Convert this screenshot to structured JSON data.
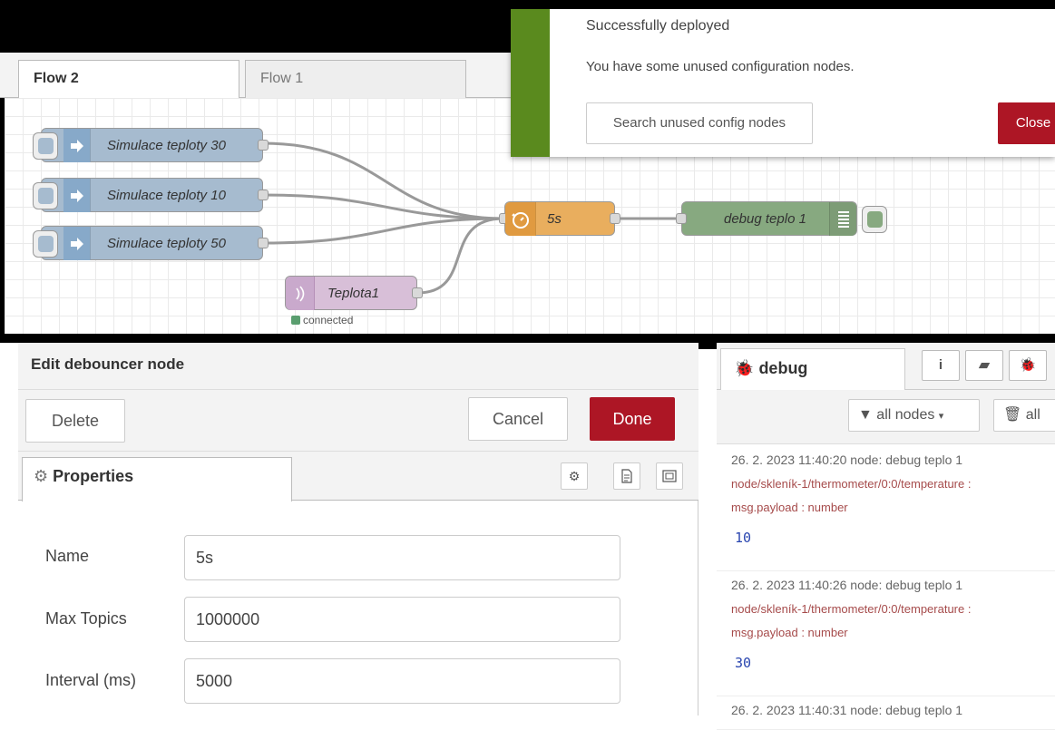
{
  "tabs": [
    {
      "label": "Flow 2",
      "active": true
    },
    {
      "label": "Flow 1",
      "active": false
    }
  ],
  "flow": {
    "inject_nodes": [
      "Simulace teploty 30",
      "Simulace teploty 10",
      "Simulace teploty 50"
    ],
    "debouncer_label": "5s",
    "debug_label": "debug teplo 1",
    "mqtt_label": "Teplota1",
    "mqtt_status": "connected"
  },
  "notification": {
    "title": "Successfully deployed",
    "message": "You have some unused configuration nodes.",
    "search_button": "Search unused config nodes",
    "close_button": "Close"
  },
  "edit": {
    "title": "Edit debouncer node",
    "delete_label": "Delete",
    "cancel_label": "Cancel",
    "done_label": "Done",
    "properties_tab": "Properties",
    "fields": [
      {
        "label": "Name",
        "value": "5s"
      },
      {
        "label": "Max Topics",
        "value": "1000000"
      },
      {
        "label": "Interval (ms)",
        "value": "5000"
      }
    ]
  },
  "debug": {
    "tab_label": "debug",
    "filter_label": "all nodes",
    "clear_label": "all",
    "messages": [
      {
        "meta": "26. 2. 2023 11:40:20   node: debug teplo 1",
        "topic": "node/skleník-1/thermometer/0:0/temperature :",
        "ptype": "msg.payload : number",
        "value": "10"
      },
      {
        "meta": "26. 2. 2023 11:40:26   node: debug teplo 1",
        "topic": "node/skleník-1/thermometer/0:0/temperature :",
        "ptype": "msg.payload : number",
        "value": "30"
      },
      {
        "meta": "26. 2. 2023 11:40:31   node: debug teplo 1",
        "topic": "",
        "ptype": "",
        "value": ""
      }
    ]
  },
  "colors": {
    "inject": "#a6bbcf",
    "debouncer": "#e9ae5e",
    "debug_node": "#87a980",
    "mqtt": "#d8bfd8",
    "primary_button": "#ad1625",
    "deploy_success": "#5a8a1e"
  }
}
